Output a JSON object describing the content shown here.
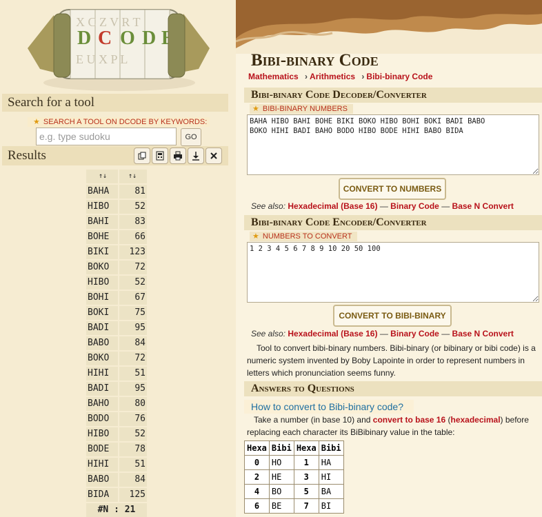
{
  "logo": {
    "letters_row1": "X C Z V R T",
    "letters_row2": "D C O D E",
    "letters_row3": "E U X P L"
  },
  "search": {
    "title": "Search for a tool",
    "label": "SEARCH A TOOL ON DCODE BY KEYWORDS:",
    "placeholder": "e.g. type sudoku",
    "go": "GO"
  },
  "results": {
    "title": "Results",
    "sort_col1": "↑↓",
    "sort_col2": "↑↓",
    "rows": [
      {
        "code": "BAHA",
        "value": "81"
      },
      {
        "code": "HIBO",
        "value": "52"
      },
      {
        "code": "BAHI",
        "value": "83"
      },
      {
        "code": "BOHE",
        "value": "66"
      },
      {
        "code": "BIKI",
        "value": "123"
      },
      {
        "code": "BOKO",
        "value": "72"
      },
      {
        "code": "HIBO",
        "value": "52"
      },
      {
        "code": "BOHI",
        "value": "67"
      },
      {
        "code": "BOKI",
        "value": "75"
      },
      {
        "code": "BADI",
        "value": "95"
      },
      {
        "code": "BABO",
        "value": "84"
      },
      {
        "code": "BOKO",
        "value": "72"
      },
      {
        "code": "HIHI",
        "value": "51"
      },
      {
        "code": "BADI",
        "value": "95"
      },
      {
        "code": "BAHO",
        "value": "80"
      },
      {
        "code": "BODO",
        "value": "76"
      },
      {
        "code": "HIBO",
        "value": "52"
      },
      {
        "code": "BODE",
        "value": "78"
      },
      {
        "code": "HIHI",
        "value": "51"
      },
      {
        "code": "BABO",
        "value": "84"
      },
      {
        "code": "BIDA",
        "value": "125"
      }
    ],
    "footer": "#N : 21"
  },
  "page": {
    "title": "Bibi-binary Code",
    "breadcrumbs": [
      "Mathematics",
      "Arithmetics",
      "Bibi-binary Code"
    ],
    "decoder": {
      "heading": "Bibi-binary Code Decoder/Converter",
      "field_label": "BIBI-BINARY NUMBERS",
      "value": "BAHA HIBO BAHI BOHE BIKI BOKO HIBO BOHI BOKI BADI BABO\nBOKO HIHI BADI BAHO BODO HIBO BODE HIHI BABO BIDA",
      "button": "CONVERT TO NUMBERS"
    },
    "encoder": {
      "heading": "Bibi-binary Code Encoder/Converter",
      "field_label": "NUMBERS TO CONVERT",
      "value": "1 2 3 4 5 6 7 8 9 10 20 50 100",
      "button": "CONVERT TO BIBI-BINARY"
    },
    "see_also_label": "See also:",
    "see_also_links": [
      "Hexadecimal (Base 16)",
      "Binary Code",
      "Base N Convert"
    ],
    "see_also_sep": "—",
    "intro": "Tool to convert bibi-binary numbers. Bibi-binary (or bibinary or bibi code) is a numeric system invented by Boby Lapointe in order to represent numbers in letters which pronunciation seems funny.",
    "faq_heading": "Answers to Questions",
    "question": "How to convert to Bibi-binary code?",
    "answer_pre": "Take a number (in base 10) and",
    "answer_link1": "convert to base 16",
    "answer_paren_open": "(",
    "answer_link2": "hexadecimal",
    "answer_post": ") before replacing each character its BiBibinary value in the table:",
    "table": {
      "headers": [
        "Hexa",
        "Bibi",
        "Hexa",
        "Bibi"
      ],
      "rows": [
        [
          "0",
          "HO",
          "1",
          "HA"
        ],
        [
          "2",
          "HE",
          "3",
          "HI"
        ],
        [
          "4",
          "BO",
          "5",
          "BA"
        ],
        [
          "6",
          "BE",
          "7",
          "BI"
        ]
      ]
    }
  },
  "colors": {
    "accent_red": "#b8121b",
    "label_red": "#b8311c",
    "panel_bg": "#f6ecd2",
    "header_bg": "#ecdfba"
  }
}
